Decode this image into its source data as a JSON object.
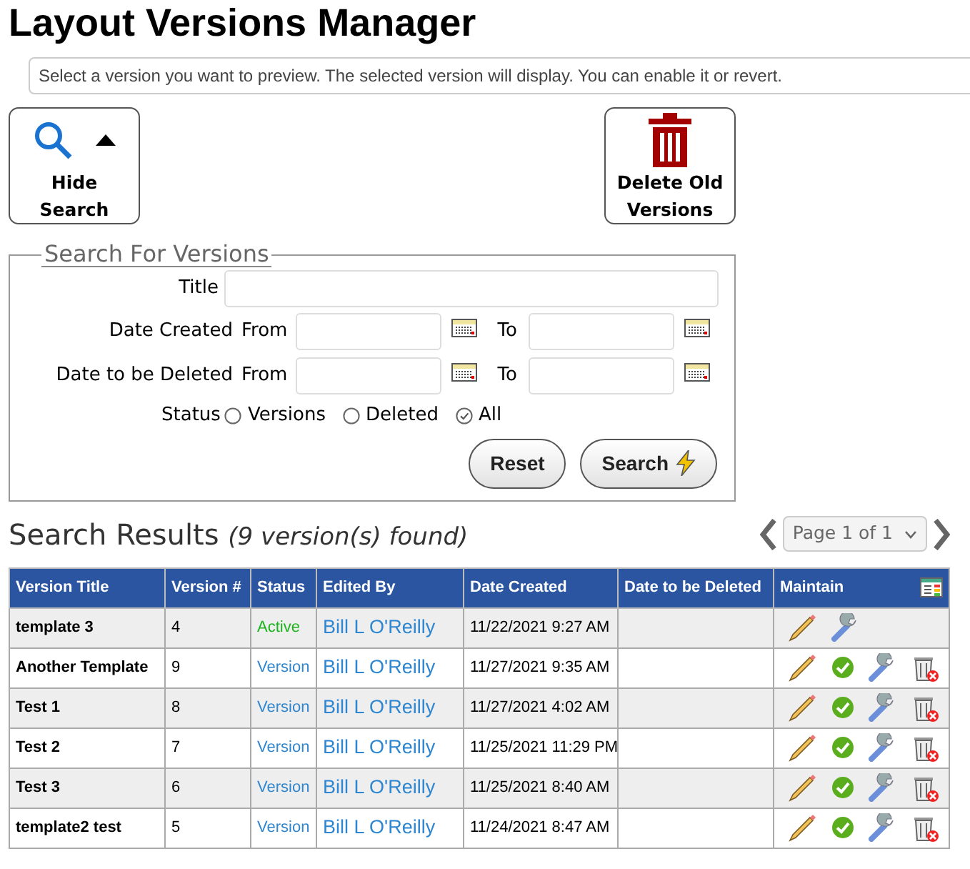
{
  "title": "Layout Versions Manager",
  "info": "Select a version you want to preview. The selected version will display. You can enable it or revert.",
  "toolbar": [
    {
      "kind": "search",
      "label_lines": [
        "Hide",
        "Search"
      ]
    },
    {
      "kind": "delete",
      "label_lines": [
        "Delete Old",
        "Versions"
      ]
    }
  ],
  "search_panel": {
    "legend": "Search For Versions",
    "title_label": "Title",
    "date_rows": [
      {
        "label": "Date Created",
        "from": "From",
        "to": "To"
      },
      {
        "label": "Date to be Deleted",
        "from": "From",
        "to": "To"
      }
    ],
    "status_label": "Status",
    "status_options": [
      {
        "label": "Versions",
        "selected": false
      },
      {
        "label": "Deleted",
        "selected": false
      },
      {
        "label": "All",
        "selected": true
      }
    ],
    "buttons": [
      {
        "kind": "reset",
        "label": "Reset"
      },
      {
        "kind": "search",
        "label": "Search"
      }
    ]
  },
  "results": {
    "heading": "Search Results",
    "count": "(9 version(s) found)",
    "pager": "Page 1 of 1",
    "columns": [
      "Version Title",
      "Version #",
      "Status",
      "Edited By",
      "Date Created",
      "Date to be Deleted",
      "Maintain"
    ],
    "rows": [
      {
        "title": "template 3",
        "version": "4",
        "status": "Active",
        "kind": "active",
        "edited_by": "Bill L O'Reilly",
        "created": "11/22/2021 9:27 AM",
        "can_enable": false,
        "can_delete": false
      },
      {
        "title": "Another Template",
        "version": "9",
        "status": "Version",
        "kind": "version",
        "edited_by": "Bill L O'Reilly",
        "created": "11/27/2021 9:35 AM",
        "can_enable": true,
        "can_delete": true
      },
      {
        "title": "Test 1",
        "version": "8",
        "status": "Version",
        "kind": "version",
        "edited_by": "Bill L O'Reilly",
        "created": "11/27/2021 4:02 AM",
        "can_enable": true,
        "can_delete": true
      },
      {
        "title": "Test 2",
        "version": "7",
        "status": "Version",
        "kind": "version",
        "edited_by": "Bill L O'Reilly",
        "created": "11/25/2021 11:29 PM",
        "can_enable": true,
        "can_delete": true
      },
      {
        "title": "Test 3",
        "version": "6",
        "status": "Version",
        "kind": "version",
        "edited_by": "Bill L O'Reilly",
        "created": "11/25/2021 8:40 AM",
        "can_enable": true,
        "can_delete": true
      },
      {
        "title": "template2 test",
        "version": "5",
        "status": "Version",
        "kind": "version",
        "edited_by": "Bill L O'Reilly",
        "created": "11/24/2021 8:47 AM",
        "can_enable": true,
        "can_delete": true
      }
    ]
  }
}
